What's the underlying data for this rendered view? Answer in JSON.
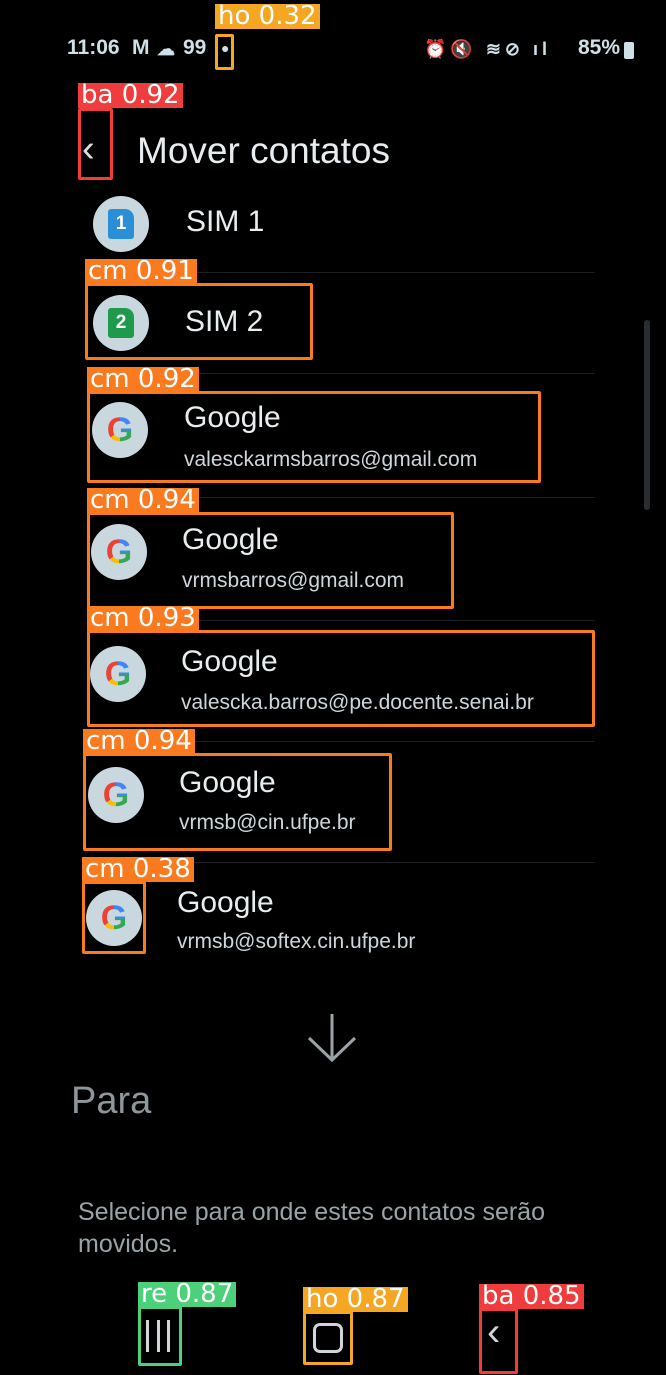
{
  "status_bar": {
    "time": "11:06",
    "left_icons": [
      "gmail-icon",
      "cloud-icon"
    ],
    "badge": "99",
    "right_icons": [
      "alarm-icon",
      "mute-icon",
      "wifi-icon",
      "dnd-icon",
      "volte-icon",
      "signal-icon"
    ],
    "battery": "85%"
  },
  "header": {
    "title": "Mover contatos"
  },
  "accounts": [
    {
      "type": "sim",
      "number": "1",
      "name": "SIM 1",
      "color": "#2a8fd6"
    },
    {
      "type": "sim",
      "number": "2",
      "name": "SIM 2",
      "color": "#1f9a4a"
    },
    {
      "type": "google",
      "name": "Google",
      "email": "valesckarmsbarros@gmail.com"
    },
    {
      "type": "google",
      "name": "Google",
      "email": "vrmsbarros@gmail.com"
    },
    {
      "type": "google",
      "name": "Google",
      "email": "valescka.barros@pe.docente.senai.br"
    },
    {
      "type": "google",
      "name": "Google",
      "email": "vrmsb@cin.ufpe.br"
    },
    {
      "type": "google",
      "name": "Google",
      "email": "vrmsb@softex.cin.ufpe.br"
    }
  ],
  "to_section": {
    "title": "Para",
    "description": "Selecione para onde estes contatos serão movidos."
  },
  "detections": [
    {
      "label": "ho 0.32",
      "color": "#f5a623"
    },
    {
      "label": "ba 0.92",
      "color": "#f03c3c"
    },
    {
      "label": "cm 0.91",
      "color": "#f97a1f"
    },
    {
      "label": "cm 0.92",
      "color": "#f97a1f"
    },
    {
      "label": "cm 0.94",
      "color": "#f97a1f"
    },
    {
      "label": "cm 0.93",
      "color": "#f97a1f"
    },
    {
      "label": "cm 0.94",
      "color": "#f97a1f"
    },
    {
      "label": "cm 0.38",
      "color": "#f97a1f"
    },
    {
      "label": "re 0.87",
      "color": "#4cd17a"
    },
    {
      "label": "ho 0.87",
      "color": "#f5a623"
    },
    {
      "label": "ba 0.85",
      "color": "#f03c3c"
    }
  ]
}
